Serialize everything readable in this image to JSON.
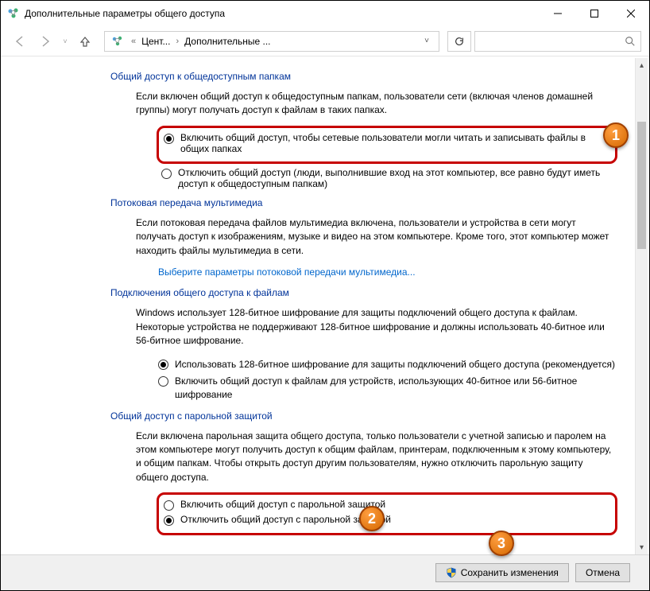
{
  "window": {
    "title": "Дополнительные параметры общего доступа"
  },
  "breadcrumb": {
    "part1": "Цент...",
    "part2": "Дополнительные ..."
  },
  "sections": {
    "publicFolders": {
      "heading": "Общий доступ к общедоступным папкам",
      "desc": "Если включен общий доступ к общедоступным папкам, пользователи сети (включая членов домашней группы) могут получать доступ к файлам в таких папках.",
      "opt1": "Включить общий доступ, чтобы сетевые пользователи могли читать и записывать файлы в общих папках",
      "opt2": "Отключить общий доступ (люди, выполнившие вход на этот компьютер, все равно будут иметь доступ к общедоступным папкам)"
    },
    "media": {
      "heading": "Потоковая передача мультимедиа",
      "desc": "Если потоковая передача файлов мультимедиа включена, пользователи и устройства в сети могут получать доступ к изображениям, музыке и видео на этом компьютере. Кроме того, этот компьютер может находить файлы мультимедиа в сети.",
      "link": "Выберите параметры потоковой передачи мультимедиа..."
    },
    "fileConn": {
      "heading": "Подключения общего доступа к файлам",
      "desc": "Windows использует 128-битное шифрование для защиты подключений общего доступа к файлам. Некоторые устройства не поддерживают 128-битное шифрование и должны использовать 40-битное или 56-битное шифрование.",
      "opt1": "Использовать 128-битное шифрование для защиты подключений общего доступа (рекомендуется)",
      "opt2": "Включить общий доступ к файлам для устройств, использующих 40-битное или 56-битное шифрование"
    },
    "password": {
      "heading": "Общий доступ с парольной защитой",
      "desc": "Если включена парольная защита общего доступа, только пользователи с учетной записью и паролем на этом компьютере могут получить доступ к общим файлам, принтерам, подключенным к этому компьютеру, и общим папкам. Чтобы открыть доступ другим пользователям, нужно отключить парольную защиту общего доступа.",
      "opt1": "Включить общий доступ с парольной защитой",
      "opt2": "Отключить общий доступ с парольной защитой"
    }
  },
  "buttons": {
    "save": "Сохранить изменения",
    "cancel": "Отмена"
  },
  "callouts": {
    "c1": "1",
    "c2": "2",
    "c3": "3"
  }
}
